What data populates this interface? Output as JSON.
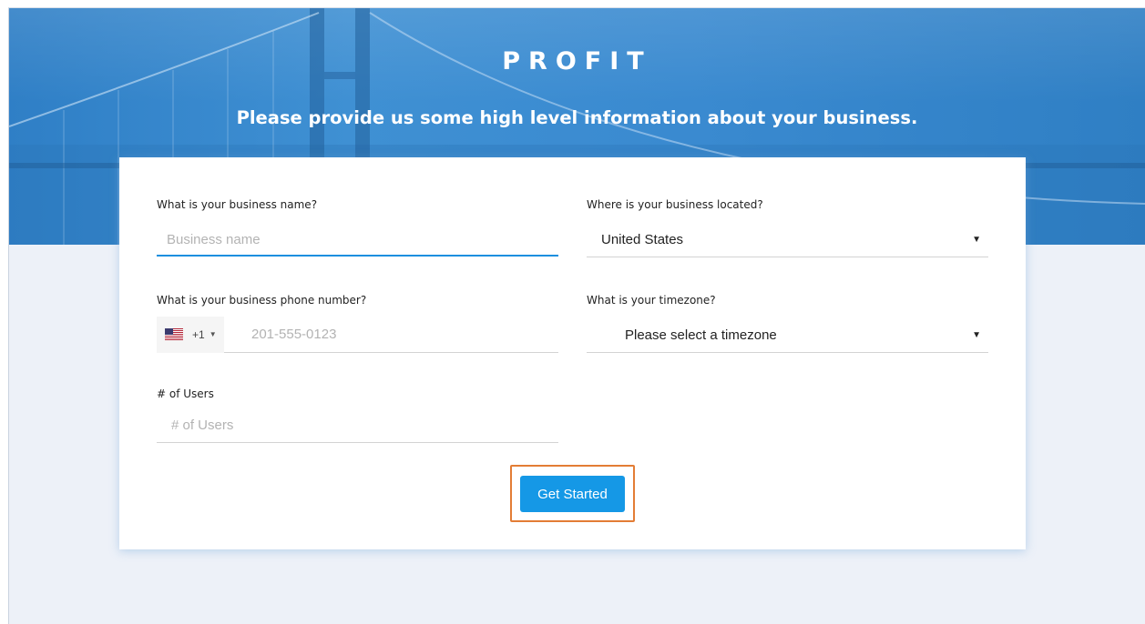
{
  "brand": {
    "logo_text": "PROFIT"
  },
  "header": {
    "headline": "Please provide us some high level information about your business."
  },
  "form": {
    "business_name": {
      "label": "What is your business name?",
      "placeholder": "Business name",
      "value": ""
    },
    "location": {
      "label": "Where is your business located?",
      "value": "United States"
    },
    "phone": {
      "label": "What is your business phone number?",
      "dial_code": "+1",
      "placeholder": "201-555-0123"
    },
    "timezone": {
      "label": "What is your timezone?",
      "value": "Please select a timezone"
    },
    "users": {
      "label": "# of Users",
      "placeholder": "# of Users"
    },
    "submit_label": "Get Started"
  },
  "colors": {
    "accent": "#1598e6",
    "highlight": "#e37d35",
    "hero": "#3a8ad0",
    "background": "#edf1f8"
  },
  "icons": {
    "flag": "us-flag-icon",
    "caret": "caret-down-icon"
  }
}
